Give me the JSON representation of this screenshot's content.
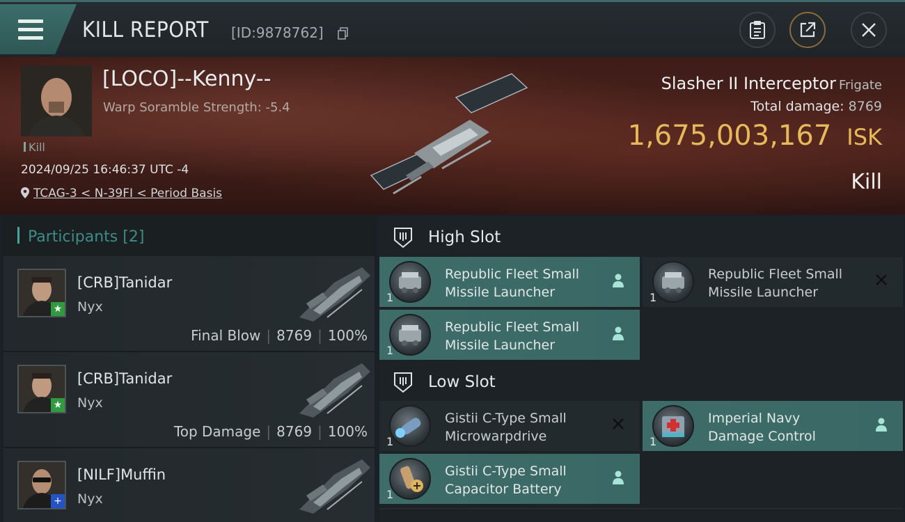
{
  "header": {
    "title": "KILL REPORT",
    "report_id": "[ID:9878762]"
  },
  "victim": {
    "name": "[LOCO]--Kenny--",
    "warp_scramble": "Warp Soramble Strength: -5.4",
    "tag": "Kill",
    "timestamp": "2024/09/25 16:46:37 UTC -4",
    "location": "TCAG-3 < N-39FI < Period Basis",
    "ship_name": "Slasher II Interceptor",
    "ship_class": "Frigate",
    "total_damage_label": "Total damage:",
    "total_damage_value": "8769",
    "isk_value": "1,675,003,167",
    "isk_unit": "ISK",
    "result": "Kill"
  },
  "participants": {
    "label": "Participants",
    "count": "[2]",
    "rows": [
      {
        "name": "[CRB]Tanidar",
        "ship": "Nyx",
        "role": "Final Blow",
        "damage": "8769",
        "percent": "100%",
        "badge": "star",
        "badge_color": "#2f9a3e"
      },
      {
        "name": "[CRB]Tanidar",
        "ship": "Nyx",
        "role": "Top Damage",
        "damage": "8769",
        "percent": "100%",
        "badge": "star",
        "badge_color": "#2f9a3e"
      },
      {
        "name": "[NILF]Muffin",
        "ship": "Nyx",
        "role": "",
        "damage": "",
        "percent": "",
        "badge": "plus",
        "badge_color": "#2552c4"
      }
    ]
  },
  "fitting": {
    "high_slot_label": "High Slot",
    "low_slot_label": "Low Slot",
    "high_modules": [
      {
        "line1": "Republic Fleet Small",
        "line2": "Missile Launcher",
        "qty": "1",
        "state": "active",
        "icon": "missile-launcher-icon"
      },
      {
        "line1": "Republic Fleet Small",
        "line2": "Missile Launcher",
        "qty": "1",
        "state": "destroyed",
        "icon": "missile-launcher-icon"
      },
      {
        "line1": "Republic Fleet Small",
        "line2": "Missile Launcher",
        "qty": "1",
        "state": "active",
        "icon": "missile-launcher-icon"
      }
    ],
    "low_modules": [
      {
        "line1": "Gistii C-Type Small",
        "line2": "Microwarpdrive",
        "qty": "1",
        "state": "destroyed",
        "icon": "microwarpdrive-icon"
      },
      {
        "line1": "Imperial Navy",
        "line2": "Damage Control",
        "qty": "1",
        "state": "active",
        "icon": "damage-control-icon"
      },
      {
        "line1": "Gistii C-Type Small",
        "line2": "Capacitor Battery",
        "qty": "1",
        "state": "active",
        "icon": "capacitor-battery-icon"
      }
    ]
  },
  "colors": {
    "accent_teal": "#3d6c69",
    "isk_gold": "#e8b95a",
    "banner_red": "#4a221c"
  }
}
